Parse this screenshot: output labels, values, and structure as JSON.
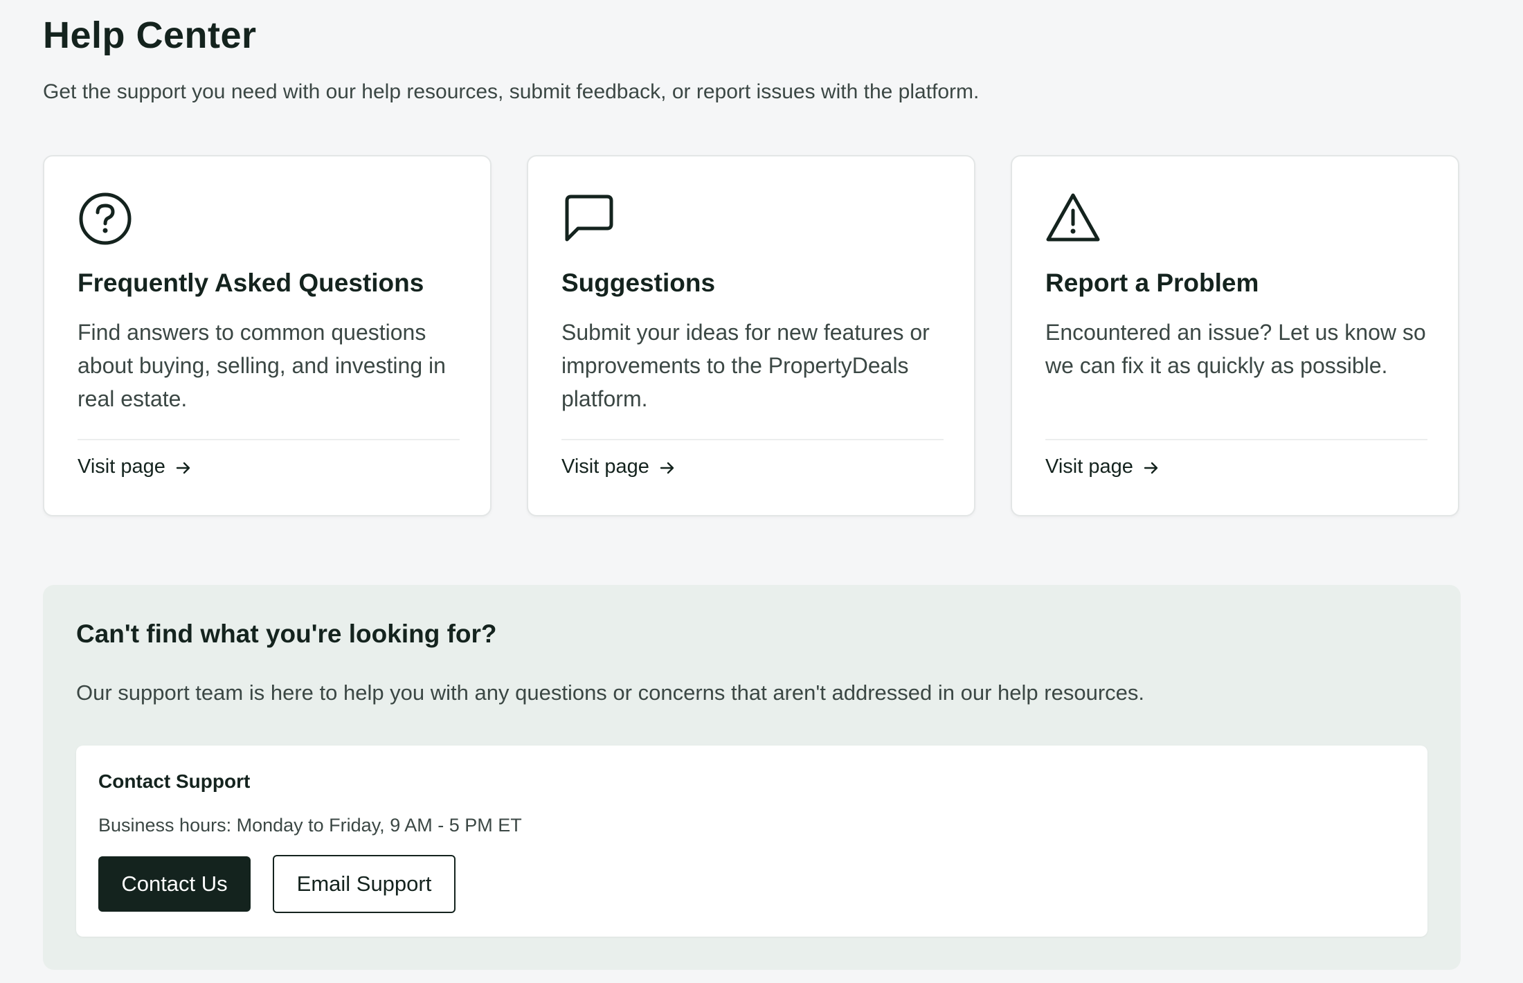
{
  "header": {
    "title": "Help Center",
    "subtitle": "Get the support you need with our help resources, submit feedback, or report issues with the platform."
  },
  "cards": [
    {
      "icon": "question-circle-icon",
      "title": "Frequently Asked Questions",
      "description": "Find answers to common questions about buying, selling, and investing in real estate.",
      "link_label": "Visit page"
    },
    {
      "icon": "message-square-icon",
      "title": "Suggestions",
      "description": "Submit your ideas for new features or improvements to the PropertyDeals platform.",
      "link_label": "Visit page"
    },
    {
      "icon": "warning-triangle-icon",
      "title": "Report a Problem",
      "description": "Encountered an issue? Let us know so we can fix it as quickly as possible.",
      "link_label": "Visit page"
    }
  ],
  "help_panel": {
    "title": "Can't find what you're looking for?",
    "description": "Our support team is here to help you with any questions or concerns that aren't addressed in our help resources.",
    "contact": {
      "title": "Contact Support",
      "hours": "Business hours: Monday to Friday, 9 AM - 5 PM ET",
      "primary_button": "Contact Us",
      "secondary_button": "Email Support"
    }
  },
  "colors": {
    "background": "#f5f6f7",
    "text_primary": "#14231e",
    "text_secondary": "#3b4744",
    "panel_background": "#e9efec",
    "button_dark": "#14231e"
  }
}
